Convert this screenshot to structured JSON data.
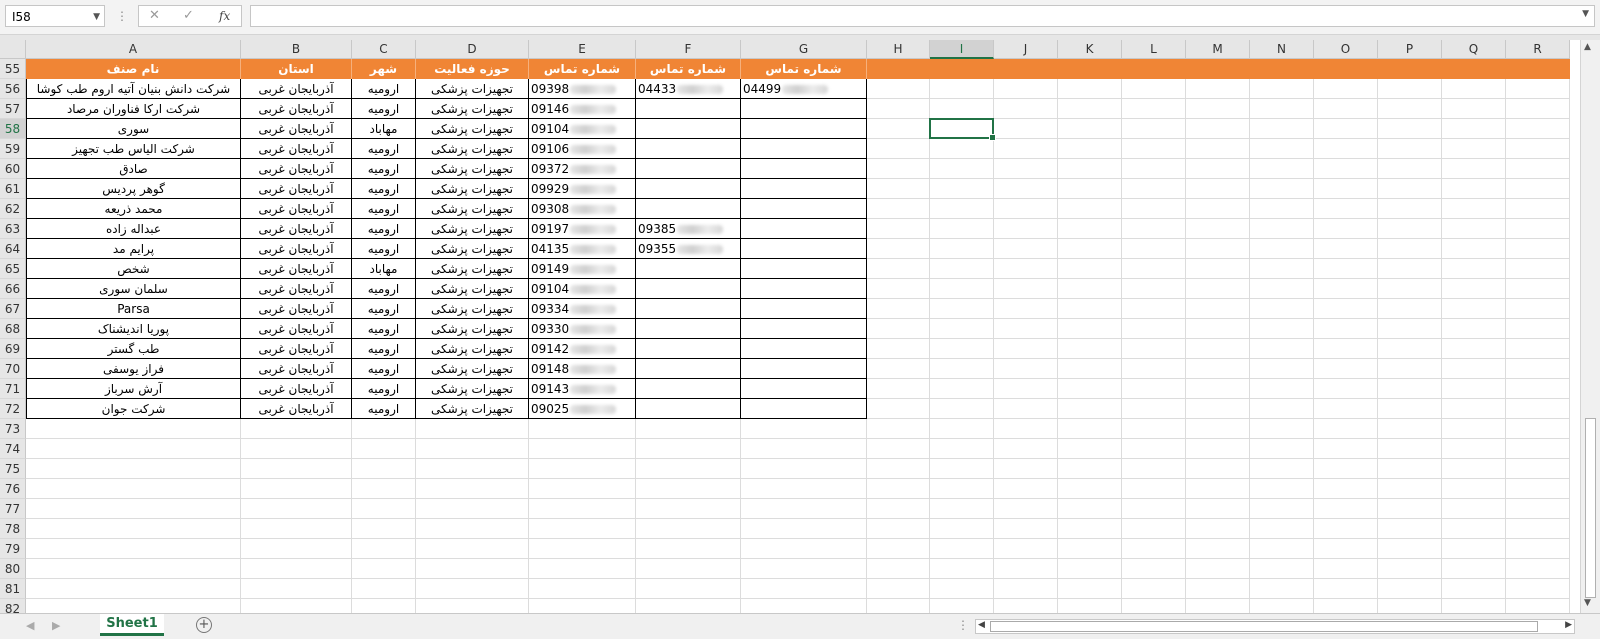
{
  "name_box": "I58",
  "formula_value": "",
  "columns": [
    "A",
    "B",
    "C",
    "D",
    "E",
    "F",
    "G",
    "H",
    "I",
    "J",
    "K",
    "L",
    "M",
    "N",
    "O",
    "P",
    "Q",
    "R"
  ],
  "selected_column": "I",
  "selected_row": "58",
  "header_row_number": "55",
  "headers": [
    "نام صنف",
    "استان",
    "شهر",
    "حوزه فعالیت",
    "شماره تماس",
    "شماره تماس",
    "شماره تماس"
  ],
  "rows": [
    {
      "n": "56",
      "name": "شرکت دانش بنیان آتیه اروم طب کوشا",
      "province": "آذربایجان غربی",
      "city": "ارومیه",
      "field": "تجهیزات پزشکی",
      "p1": "09398",
      "p2": "04433",
      "p3": "04499"
    },
    {
      "n": "57",
      "name": "شرکت ارکا فناوران مرصاد",
      "province": "آذربایجان غربی",
      "city": "ارومیه",
      "field": "تجهیزات پزشکی",
      "p1": "09146",
      "p2": "",
      "p3": ""
    },
    {
      "n": "58",
      "name": "سوری",
      "province": "آذربایجان غربی",
      "city": "مهاباد",
      "field": "تجهیزات پزشکی",
      "p1": "09104",
      "p2": "",
      "p3": ""
    },
    {
      "n": "59",
      "name": "شرکت الیاس طب تجهیز",
      "province": "آذربایجان غربی",
      "city": "ارومیه",
      "field": "تجهیزات پزشکی",
      "p1": "09106",
      "p2": "",
      "p3": ""
    },
    {
      "n": "60",
      "name": "صادق",
      "province": "آذربایجان غربی",
      "city": "ارومیه",
      "field": "تجهیزات پزشکی",
      "p1": "09372",
      "p2": "",
      "p3": ""
    },
    {
      "n": "61",
      "name": "گوهر پردیس",
      "province": "آذربایجان غربی",
      "city": "ارومیه",
      "field": "تجهیزات پزشکی",
      "p1": "09929",
      "p2": "",
      "p3": ""
    },
    {
      "n": "62",
      "name": "محمد ذریعه",
      "province": "آذربایجان غربی",
      "city": "ارومیه",
      "field": "تجهیزات پزشکی",
      "p1": "09308",
      "p2": "",
      "p3": ""
    },
    {
      "n": "63",
      "name": "عبداله زاده",
      "province": "آذربایجان غربی",
      "city": "ارومیه",
      "field": "تجهیزات پزشکی",
      "p1": "09197",
      "p2": "09385",
      "p3": ""
    },
    {
      "n": "64",
      "name": "پرایم مد",
      "province": "آذربایجان غربی",
      "city": "ارومیه",
      "field": "تجهیزات پزشکی",
      "p1": "04135",
      "p2": "09355",
      "p3": ""
    },
    {
      "n": "65",
      "name": "شخص",
      "province": "آذربایجان غربی",
      "city": "مهاباد",
      "field": "تجهیزات پزشکی",
      "p1": "09149",
      "p2": "",
      "p3": ""
    },
    {
      "n": "66",
      "name": "سلمان سوری",
      "province": "آذربایجان غربی",
      "city": "ارومیه",
      "field": "تجهیزات پزشکی",
      "p1": "09104",
      "p2": "",
      "p3": ""
    },
    {
      "n": "67",
      "name": "Parsa",
      "province": "آذربایجان غربی",
      "city": "ارومیه",
      "field": "تجهیزات پزشکی",
      "p1": "09334",
      "p2": "",
      "p3": ""
    },
    {
      "n": "68",
      "name": "پوریا اندیشناک",
      "province": "آذربایجان غربی",
      "city": "ارومیه",
      "field": "تجهیزات پزشکی",
      "p1": "09330",
      "p2": "",
      "p3": ""
    },
    {
      "n": "69",
      "name": "طب گستر",
      "province": "آذربایجان غربی",
      "city": "ارومیه",
      "field": "تجهیزات پزشکی",
      "p1": "09142",
      "p2": "",
      "p3": ""
    },
    {
      "n": "70",
      "name": "فراز یوسفی",
      "province": "آذربایجان غربی",
      "city": "ارومیه",
      "field": "تجهیزات پزشکی",
      "p1": "09148",
      "p2": "",
      "p3": ""
    },
    {
      "n": "71",
      "name": "آرش سرباز",
      "province": "آذربایجان غربی",
      "city": "ارومیه",
      "field": "تجهیزات پزشکی",
      "p1": "09143",
      "p2": "",
      "p3": ""
    },
    {
      "n": "72",
      "name": "شرکت جوان",
      "province": "آذربایجان غربی",
      "city": "ارومیه",
      "field": "تجهیزات پزشکی",
      "p1": "09025",
      "p2": "",
      "p3": ""
    }
  ],
  "empty_rows": [
    "73",
    "74",
    "75",
    "76",
    "77",
    "78",
    "79",
    "80",
    "81",
    "82"
  ],
  "sheet_tab": "Sheet1",
  "accent_color": "#217346",
  "header_fill_color": "#f08535"
}
